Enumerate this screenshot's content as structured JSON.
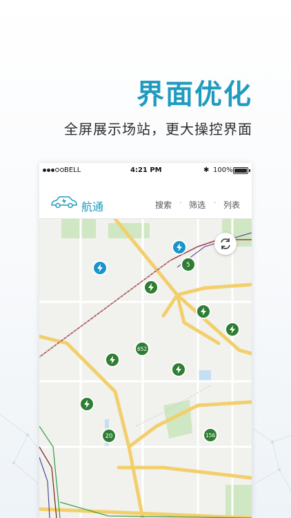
{
  "promo": {
    "title": "界面优化",
    "subtitle": "全屏展示场站，更大操控界面"
  },
  "status_bar": {
    "carrier": "BELL",
    "time": "4:21 PM",
    "battery": "100%"
  },
  "nav": {
    "app_name": "航通",
    "search": "搜索",
    "filter": "筛选",
    "list": "列表",
    "separator": "·"
  },
  "map": {
    "stations": [
      {
        "type": "fast",
        "color": "#1a94c9"
      },
      {
        "type": "fast",
        "color": "#1a94c9"
      },
      {
        "type": "cluster",
        "label": "5",
        "color": "#2e7d32"
      },
      {
        "type": "fast",
        "color": "#2e7d32"
      },
      {
        "type": "fast",
        "color": "#2e7d32"
      },
      {
        "type": "fast",
        "color": "#2e7d32"
      },
      {
        "type": "cluster",
        "label": "652",
        "color": "#2e7d32"
      },
      {
        "type": "fast",
        "color": "#2e7d32"
      },
      {
        "type": "fast",
        "color": "#2e7d32"
      },
      {
        "type": "fast",
        "color": "#2e7d32"
      },
      {
        "type": "cluster",
        "label": "20",
        "color": "#2e7d32"
      },
      {
        "type": "cluster",
        "label": "156",
        "color": "#2e7d32"
      }
    ],
    "colors": {
      "accent": "#1f9bbf",
      "road_major": "#f3cf6b",
      "park": "#cfe7c2"
    }
  }
}
